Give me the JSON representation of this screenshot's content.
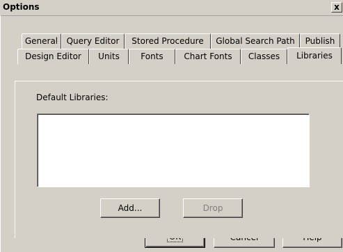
{
  "window": {
    "title": "Options",
    "close_glyph": "x"
  },
  "tabs": {
    "row_back": [
      "General",
      "Query Editor",
      "Stored Procedure",
      "Global Search Path",
      "Publish"
    ],
    "row_front": [
      "Design Editor",
      "Units",
      "Fonts",
      "Chart Fonts",
      "Classes",
      "Libraries"
    ],
    "active": "Libraries"
  },
  "libraries": {
    "default_label": "Default Libraries:",
    "items": [],
    "add_button": "Add...",
    "drop_button": "Drop",
    "drop_enabled": false
  },
  "footer": {
    "ok": "OK",
    "cancel": "Cancel",
    "help": "Help"
  }
}
